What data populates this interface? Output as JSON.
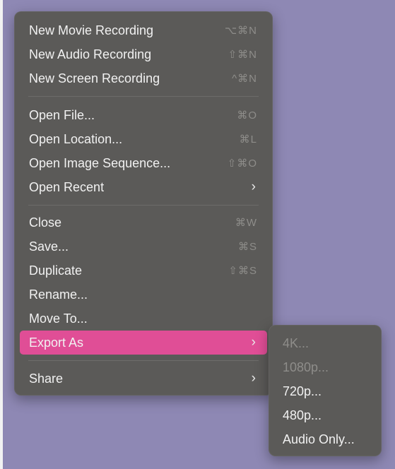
{
  "menu": {
    "items": [
      {
        "label": "New Movie Recording",
        "shortcut": "⌥⌘N"
      },
      {
        "label": "New Audio Recording",
        "shortcut": "⇧⌘N"
      },
      {
        "label": "New Screen Recording",
        "shortcut": "^⌘N"
      },
      {
        "label": "Open File...",
        "shortcut": "⌘O"
      },
      {
        "label": "Open Location...",
        "shortcut": "⌘L"
      },
      {
        "label": "Open Image Sequence...",
        "shortcut": "⇧⌘O"
      },
      {
        "label": "Open Recent",
        "chevron": "›"
      },
      {
        "label": "Close",
        "shortcut": "⌘W"
      },
      {
        "label": "Save...",
        "shortcut": "⌘S"
      },
      {
        "label": "Duplicate",
        "shortcut": "⇧⌘S"
      },
      {
        "label": "Rename..."
      },
      {
        "label": "Move To..."
      },
      {
        "label": "Export As",
        "chevron": "›",
        "highlighted": true
      },
      {
        "label": "Share",
        "chevron": "›"
      }
    ]
  },
  "submenu": {
    "items": [
      {
        "label": "4K...",
        "enabled": false
      },
      {
        "label": "1080p...",
        "enabled": false
      },
      {
        "label": "720p...",
        "enabled": true
      },
      {
        "label": "480p...",
        "enabled": true
      },
      {
        "label": "Audio Only...",
        "enabled": true
      }
    ]
  },
  "colors": {
    "desktop": "#8e88b4",
    "menu_background": "#5b5a58",
    "highlight": "#e04e96",
    "text": "#f1f1f1",
    "disabled_text": "#8e8d8a"
  },
  "icons": {
    "submenu_indicator": "chevron-right-icon"
  }
}
